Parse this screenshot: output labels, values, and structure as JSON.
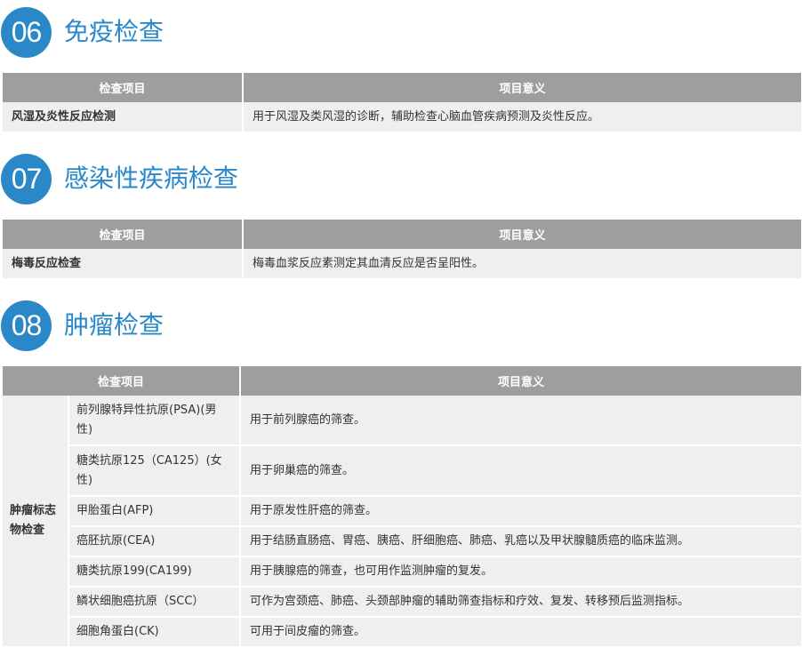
{
  "sections": [
    {
      "number": "06",
      "title": "免疫检查",
      "header": [
        "检查项目",
        "项目意义"
      ],
      "rows": [
        {
          "item": "风湿及炎性反应检测",
          "meaning": "用于风湿及类风湿的诊断，辅助检查心脑血管疾病预测及炎性反应。"
        }
      ]
    },
    {
      "number": "07",
      "title": "感染性疾病检查",
      "header": [
        "检查项目",
        "项目意义"
      ],
      "rows": [
        {
          "item": "梅毒反应检查",
          "meaning": "梅毒血浆反应素测定其血清反应是否呈阳性。"
        }
      ]
    },
    {
      "number": "08",
      "title": "肿瘤检查",
      "header": [
        "检查项目",
        "项目意义"
      ],
      "group": "肿瘤标志物检查",
      "rows": [
        {
          "item": "前列腺特异性抗原(PSA)(男性)",
          "meaning": "用于前列腺癌的筛查。"
        },
        {
          "item": "糖类抗原125（CA125）(女性)",
          "meaning": "用于卵巢癌的筛查。"
        },
        {
          "item": "甲胎蛋白(AFP)",
          "meaning": "用于原发性肝癌的筛查。"
        },
        {
          "item": "癌胚抗原(CEA)",
          "meaning": "用于结肠直肠癌、胃癌、胰癌、肝细胞癌、肺癌、乳癌以及甲状腺髓质癌的临床监测。"
        },
        {
          "item": "糖类抗原199(CA199)",
          "meaning": "用于胰腺癌的筛查，也可用作监测肿瘤的复发。"
        },
        {
          "item": "鳞状细胞癌抗原（SCC）",
          "meaning": "可作为宫颈癌、肺癌、头颈部肿瘤的辅助筛查指标和疗效、复发、转移预后监测指标。"
        },
        {
          "item": "细胞角蛋白(CK)",
          "meaning": "可用于间皮瘤的筛查。"
        }
      ]
    }
  ]
}
